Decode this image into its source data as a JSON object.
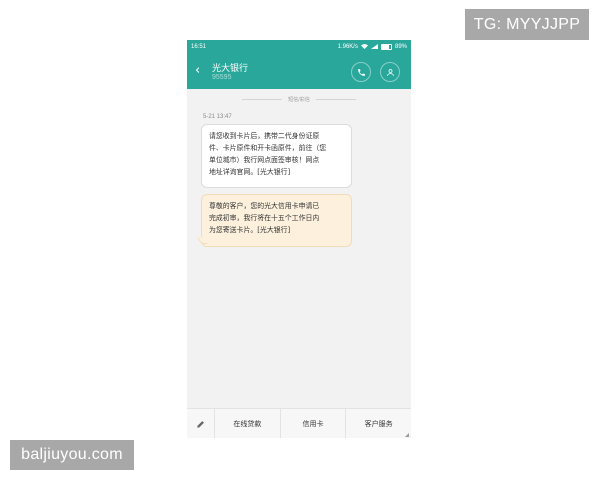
{
  "watermarks": {
    "top_right": "TG: MYYJJPP",
    "bottom_left": "baljiuyou.com"
  },
  "status_bar": {
    "time": "16:51",
    "net_speed": "1.96K/s",
    "battery": "89%"
  },
  "header": {
    "title": "光大银行",
    "subtitle": "95595",
    "back_icon": "chevron-left-icon",
    "call_icon": "phone-icon",
    "contact_icon": "person-icon"
  },
  "conversation": {
    "divider_label": "短信/彩信",
    "timestamp": "5-21 13:47",
    "messages": [
      {
        "lines": [
          "请您收到卡片后，携带二代身份证原",
          "件、卡片原件和开卡函原件，前往（您",
          "单位城市）我行网点面签审核！网点",
          "地址详询官网。[光大银行]"
        ]
      },
      {
        "lines": [
          "尊敬的客户，您的光大信用卡申请已",
          "完成初审，我行将在十五个工作日内",
          "为您寄送卡片。[光大银行]"
        ]
      }
    ]
  },
  "bottom_menu": {
    "edit_icon": "pencil-icon",
    "items": [
      "在线贷款",
      "信用卡",
      "客户服务"
    ]
  },
  "colors": {
    "header_bg": "#2aa79b",
    "incoming_bubble": "#ffffff",
    "highlight_bubble": "#fdf1de"
  }
}
